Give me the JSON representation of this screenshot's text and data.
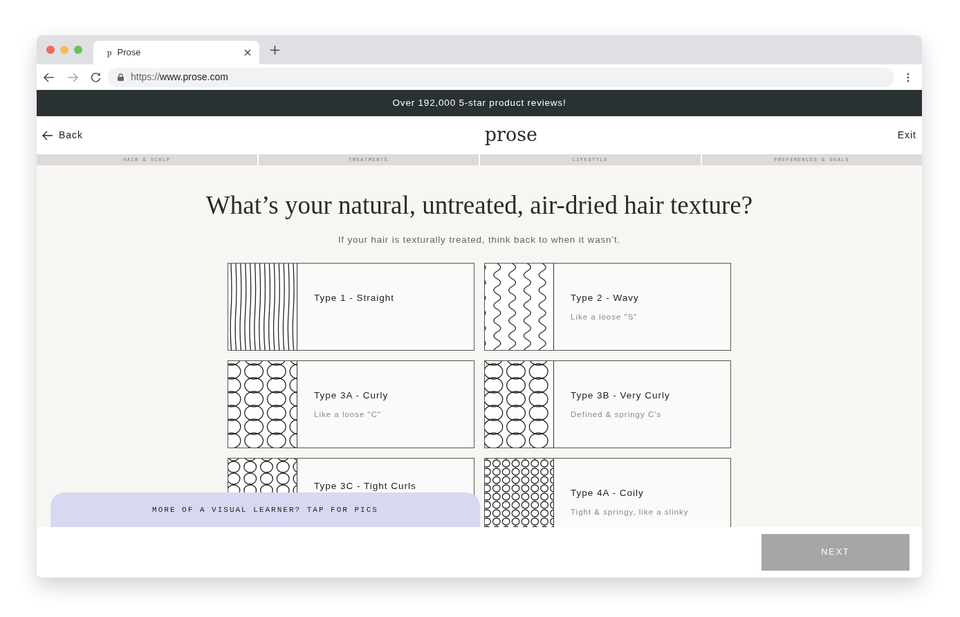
{
  "browser": {
    "tab_title": "Prose",
    "tab_icon": "p",
    "url_scheme": "https://",
    "url_host": "www.prose.com"
  },
  "promo": "Over 192,000 5-star product reviews!",
  "header": {
    "back": "Back",
    "logo": "prose",
    "exit": "Exit"
  },
  "steps": [
    "HAIR & SCALP",
    "TREATMENTS",
    "LIFESTYLE",
    "PREFERENCES & GOALS"
  ],
  "question": {
    "title": "What’s your natural, untreated, air-dried hair texture?",
    "hint": "If your hair is texturally treated, think back to when it wasn’t."
  },
  "options": [
    {
      "kind": "straight",
      "title": "Type 1 - Straight"
    },
    {
      "kind": "wavy",
      "title": "Type 2 - Wavy",
      "subtitle": "Like a loose \"S\""
    },
    {
      "kind": "curly",
      "title": "Type 3A - Curly",
      "subtitle": "Like a loose \"C\""
    },
    {
      "kind": "very-curly",
      "title": "Type 3B - Very Curly",
      "subtitle": "Defined & springy C's"
    },
    {
      "kind": "tight",
      "title": "Type 3C - Tight Curls"
    },
    {
      "kind": "coily",
      "title": "Type 4A - Coily",
      "subtitle": "Tight & springy, like a slinky"
    }
  ],
  "visual_banner": "MORE OF A VISUAL LEARNER? TAP FOR PICS",
  "next_button": {
    "label": "NEXT",
    "disabled": true
  }
}
